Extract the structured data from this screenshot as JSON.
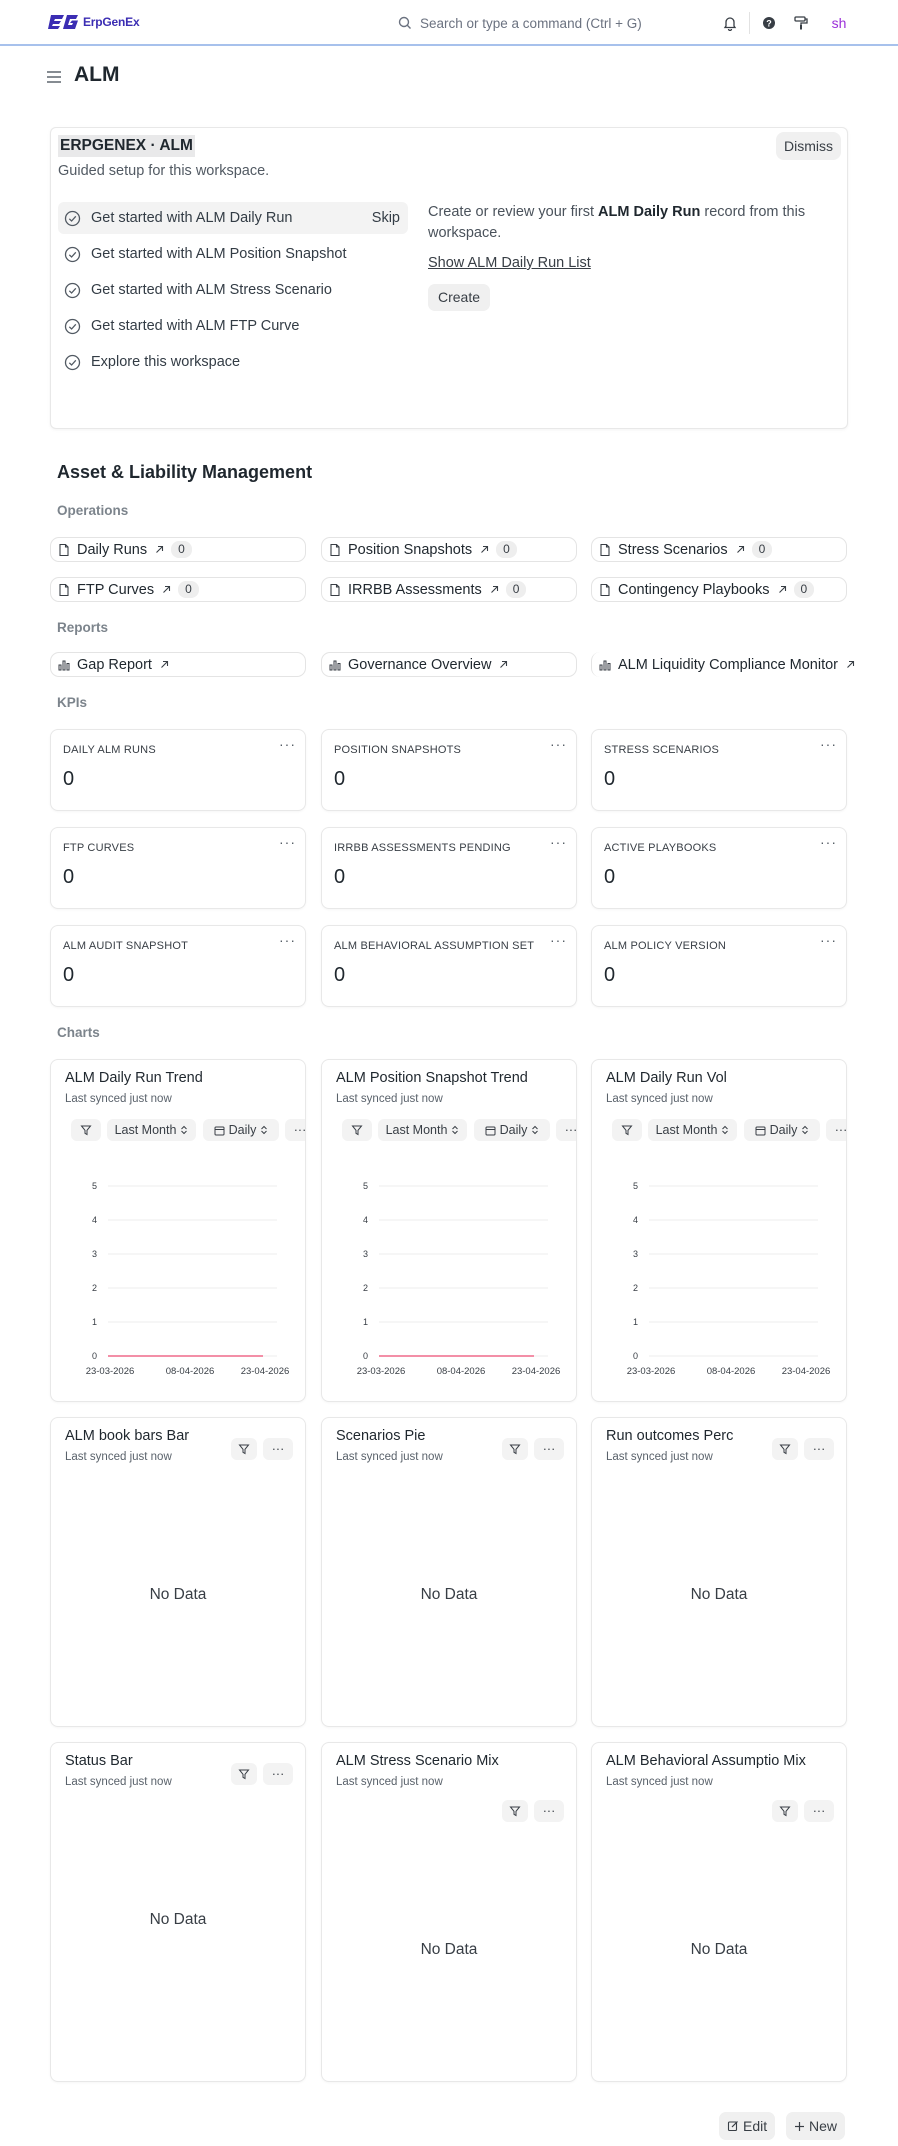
{
  "navbar": {
    "logo_text": "ErpGenEx",
    "search_placeholder": "Search or type a command (Ctrl + G)",
    "avatar_initials": "sh"
  },
  "page": {
    "title": "ALM"
  },
  "onboarding": {
    "title": "ERPGENEX · ALM",
    "subtitle": "Guided setup for this workspace.",
    "dismiss_label": "Dismiss",
    "steps": [
      {
        "label": "Get started with ALM Daily Run",
        "skip": "Skip"
      },
      {
        "label": "Get started with ALM Position Snapshot"
      },
      {
        "label": "Get started with ALM Stress Scenario"
      },
      {
        "label": "Get started with ALM FTP Curve"
      },
      {
        "label": "Explore this workspace"
      }
    ],
    "detail": {
      "text_before": "Create or review your first ",
      "text_bold": "ALM Daily Run",
      "text_after": " record from this workspace.",
      "link_label": "Show ALM Daily Run List",
      "create_label": "Create"
    }
  },
  "workspace": {
    "title": "Asset & Liability Management",
    "operations_label": "Operations",
    "operations": [
      {
        "label": "Daily Runs",
        "count": "0"
      },
      {
        "label": "Position Snapshots",
        "count": "0"
      },
      {
        "label": "Stress Scenarios",
        "count": "0"
      },
      {
        "label": "FTP Curves",
        "count": "0"
      },
      {
        "label": "IRRBB Assessments",
        "count": "0"
      },
      {
        "label": "Contingency Playbooks",
        "count": "0"
      }
    ],
    "reports_label": "Reports",
    "reports": [
      {
        "label": "Gap Report"
      },
      {
        "label": "Governance Overview"
      },
      {
        "label": "ALM Liquidity Compliance Monitor"
      }
    ],
    "kpis_label": "KPIs",
    "kpis": [
      {
        "label": "DAILY ALM RUNS",
        "value": "0"
      },
      {
        "label": "POSITION SNAPSHOTS",
        "value": "0"
      },
      {
        "label": "STRESS SCENARIOS",
        "value": "0"
      },
      {
        "label": "FTP CURVES",
        "value": "0"
      },
      {
        "label": "IRRBB ASSESSMENTS PENDING",
        "value": "0"
      },
      {
        "label": "ACTIVE PLAYBOOKS",
        "value": "0"
      },
      {
        "label": "ALM AUDIT SNAPSHOT",
        "value": "0"
      },
      {
        "label": "ALM BEHAVIORAL ASSUMPTION SET",
        "value": "0"
      },
      {
        "label": "ALM POLICY VERSION",
        "value": "0"
      }
    ],
    "kpi_menu": "···",
    "charts_label": "Charts",
    "synced_text": "Last synced just now",
    "no_data": "No Data",
    "range_label": "Last Month",
    "interval_label": "Daily",
    "line_charts": [
      {
        "title": "ALM Daily Run Trend"
      },
      {
        "title": "ALM Position Snapshot Trend"
      },
      {
        "title": "ALM Daily Run Vol"
      }
    ],
    "empty_charts": [
      {
        "title": "ALM book bars Bar"
      },
      {
        "title": "Scenarios Pie"
      },
      {
        "title": "Run outcomes Perc"
      },
      {
        "title": "Status Bar"
      },
      {
        "title": "ALM Stress Scenario Mix"
      },
      {
        "title": "ALM Behavioral Assumptio Mix"
      }
    ]
  },
  "chart_data": [
    {
      "type": "line",
      "x": [
        "23-03-2026",
        "08-04-2026",
        "23-04-2026"
      ],
      "series": [
        {
          "values": [
            0,
            0,
            0
          ]
        }
      ],
      "ylim": [
        0,
        5
      ],
      "yticks": [
        "0",
        "1",
        "2",
        "3",
        "4",
        "5"
      ],
      "color": "#ef6a8a"
    },
    {
      "type": "line",
      "x": [
        "23-03-2026",
        "08-04-2026",
        "23-04-2026"
      ],
      "series": [
        {
          "values": [
            0,
            0,
            0
          ]
        }
      ],
      "ylim": [
        0,
        5
      ],
      "yticks": [
        "0",
        "1",
        "2",
        "3",
        "4",
        "5"
      ],
      "color": "#ef6a8a"
    },
    {
      "type": "line",
      "x": [
        "23-03-2026",
        "08-04-2026",
        "23-04-2026"
      ],
      "series": [
        {
          "values": []
        }
      ],
      "ylim": [
        0,
        5
      ],
      "yticks": [
        "0",
        "1",
        "2",
        "3",
        "4",
        "5"
      ],
      "color": "#ef6a8a"
    }
  ],
  "footer": {
    "edit_label": "Edit",
    "new_label": "New"
  },
  "colors": {
    "accent": "#3b2db3",
    "navbar_border": "#a7c1ec",
    "avatar": "#9b30d9",
    "line": "#ef6a8a"
  }
}
